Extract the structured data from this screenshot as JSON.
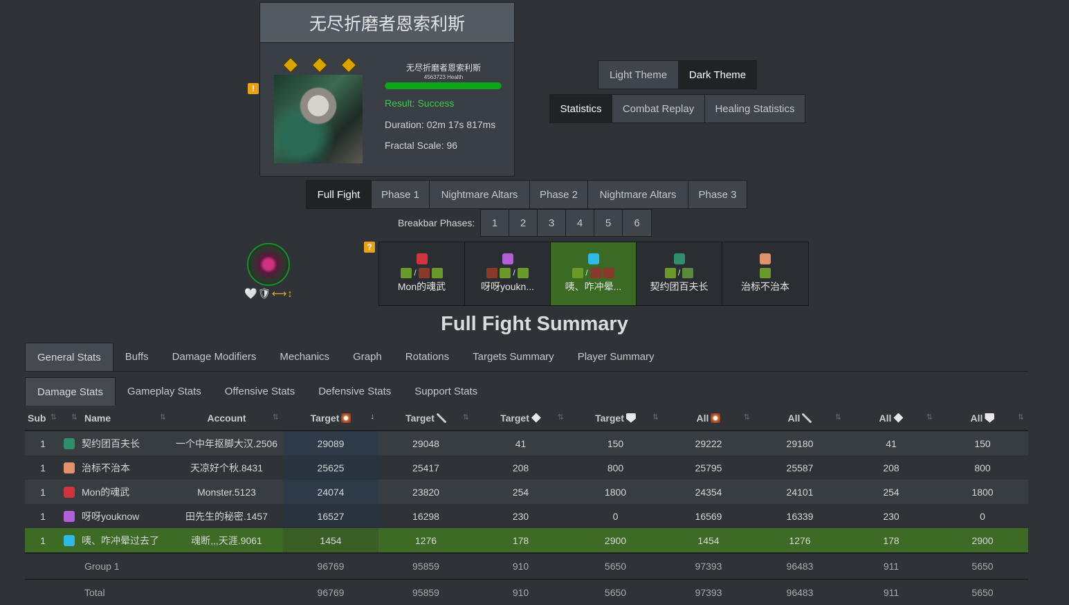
{
  "encounter": {
    "title": "无尽折磨者恩索利斯",
    "boss_name": "无尽折磨者恩索利斯",
    "health": "4563723 Health",
    "health_percent": 100,
    "result": "Result: Success",
    "duration": "Duration: 02m 17s 817ms",
    "fractal_scale": "Fractal Scale: 96",
    "warning_icon": "!"
  },
  "theme": {
    "light": "Light Theme",
    "dark": "Dark Theme",
    "active": "dark"
  },
  "views": [
    "Statistics",
    "Combat Replay",
    "Healing Statistics"
  ],
  "phases": [
    "Full Fight",
    "Phase 1",
    "Nightmare Altars",
    "Phase 2",
    "Nightmare Altars",
    "Phase 3"
  ],
  "breakbar": {
    "label": "Breakbar Phases:",
    "items": [
      "1",
      "2",
      "3",
      "4",
      "5",
      "6"
    ]
  },
  "target": {
    "glyphs": "🤍🛡",
    "arrows": "⟷↕"
  },
  "help_icon": "?",
  "squad": [
    {
      "name": "Mon的魂武",
      "prof_color": "#d0343d",
      "highlight": false
    },
    {
      "name": "呀呀youkn...",
      "prof_color": "#b35fd8",
      "highlight": false
    },
    {
      "name": "咦、咋冲晕...",
      "prof_color": "#2fb9e6",
      "highlight": true
    },
    {
      "name": "契约团百夫长",
      "prof_color": "#2e8f6a",
      "highlight": false
    },
    {
      "name": "治标不治本",
      "prof_color": "#e0926a",
      "highlight": false
    }
  ],
  "summary_title": "Full Fight Summary",
  "main_tabs": [
    "General Stats",
    "Buffs",
    "Damage Modifiers",
    "Mechanics",
    "Graph",
    "Rotations",
    "Targets Summary",
    "Player Summary"
  ],
  "sub_tabs": [
    "Damage Stats",
    "Gameplay Stats",
    "Offensive Stats",
    "Defensive Stats",
    "Support Stats"
  ],
  "table": {
    "headers": [
      "Sub",
      "",
      "Name",
      "Account",
      "Target",
      "Target",
      "Target",
      "Target",
      "All",
      "All",
      "All",
      "All"
    ],
    "rows": [
      {
        "sub": "1",
        "name": "契约团百夫长",
        "account": "一个中年抠脚大汉.2506",
        "icon_color": "#2e8f6a",
        "values": [
          "29089",
          "29048",
          "41",
          "150",
          "29222",
          "29180",
          "41",
          "150"
        ]
      },
      {
        "sub": "1",
        "name": "治标不治本",
        "account": "天凉好个秋.8431",
        "icon_color": "#e0926a",
        "values": [
          "25625",
          "25417",
          "208",
          "800",
          "25795",
          "25587",
          "208",
          "800"
        ]
      },
      {
        "sub": "1",
        "name": "Mon的魂武",
        "account": "Monster.5123",
        "icon_color": "#d0343d",
        "values": [
          "24074",
          "23820",
          "254",
          "1800",
          "24354",
          "24101",
          "254",
          "1800"
        ]
      },
      {
        "sub": "1",
        "name": "呀呀youknow",
        "account": "田先生的秘密.1457",
        "icon_color": "#b35fd8",
        "values": [
          "16527",
          "16298",
          "230",
          "0",
          "16569",
          "16339",
          "230",
          "0"
        ]
      },
      {
        "sub": "1",
        "name": "咦、咋冲晕过去了",
        "account": "魂断,,,天涯.9061",
        "icon_color": "#2fb9e6",
        "values": [
          "1454",
          "1276",
          "178",
          "2900",
          "1454",
          "1276",
          "178",
          "2900"
        ],
        "highlight": true
      }
    ],
    "footer": [
      {
        "label": "Group 1",
        "values": [
          "96769",
          "95859",
          "910",
          "5650",
          "97393",
          "96483",
          "911",
          "5650"
        ]
      },
      {
        "label": "Total",
        "values": [
          "96769",
          "95859",
          "910",
          "5650",
          "97393",
          "96483",
          "911",
          "5650"
        ]
      }
    ]
  }
}
